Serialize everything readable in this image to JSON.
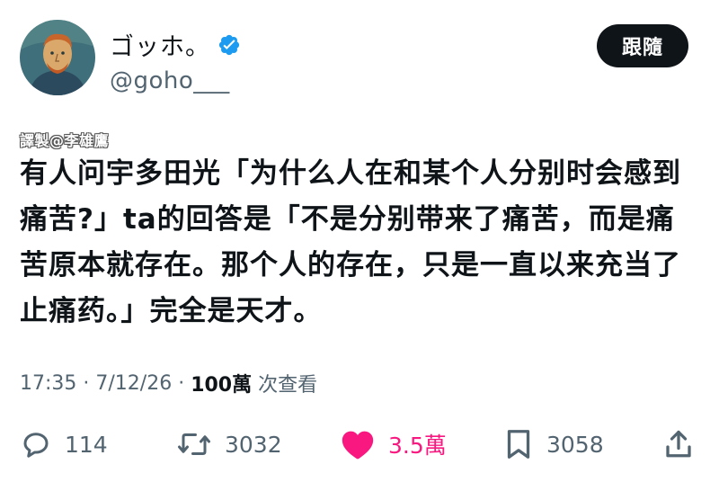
{
  "author": {
    "display_name": "ゴッホ。",
    "handle": "@goho___",
    "verified": true,
    "avatar_icon": "van-gogh-portrait-avatar"
  },
  "follow_button": {
    "label": "跟隨"
  },
  "watermark": "譯製@李雄鷹",
  "tweet": {
    "text": "有人问宇多田光「为什么人在和某个人分别时会感到痛苦?」ta的回答是「不是分别带来了痛苦，而是痛苦原本就存在。那个人的存在，只是一直以来充当了止痛药。」完全是天才。"
  },
  "meta": {
    "time": "17:35",
    "date": "7/12/26",
    "separator": " · ",
    "views_count": "100萬",
    "views_label": " 次查看"
  },
  "actions": {
    "reply": {
      "icon": "reply-icon",
      "count": "114"
    },
    "retweet": {
      "icon": "retweet-icon",
      "count": "3032"
    },
    "like": {
      "icon": "heart-icon",
      "count": "3.5萬",
      "active": true
    },
    "bookmark": {
      "icon": "bookmark-icon",
      "count": "3058"
    },
    "share": {
      "icon": "share-icon"
    }
  },
  "colors": {
    "verified_blue": "#1d9bf0",
    "like_pink": "#f91880",
    "secondary_text": "#536471",
    "primary_text": "#0f1419"
  }
}
